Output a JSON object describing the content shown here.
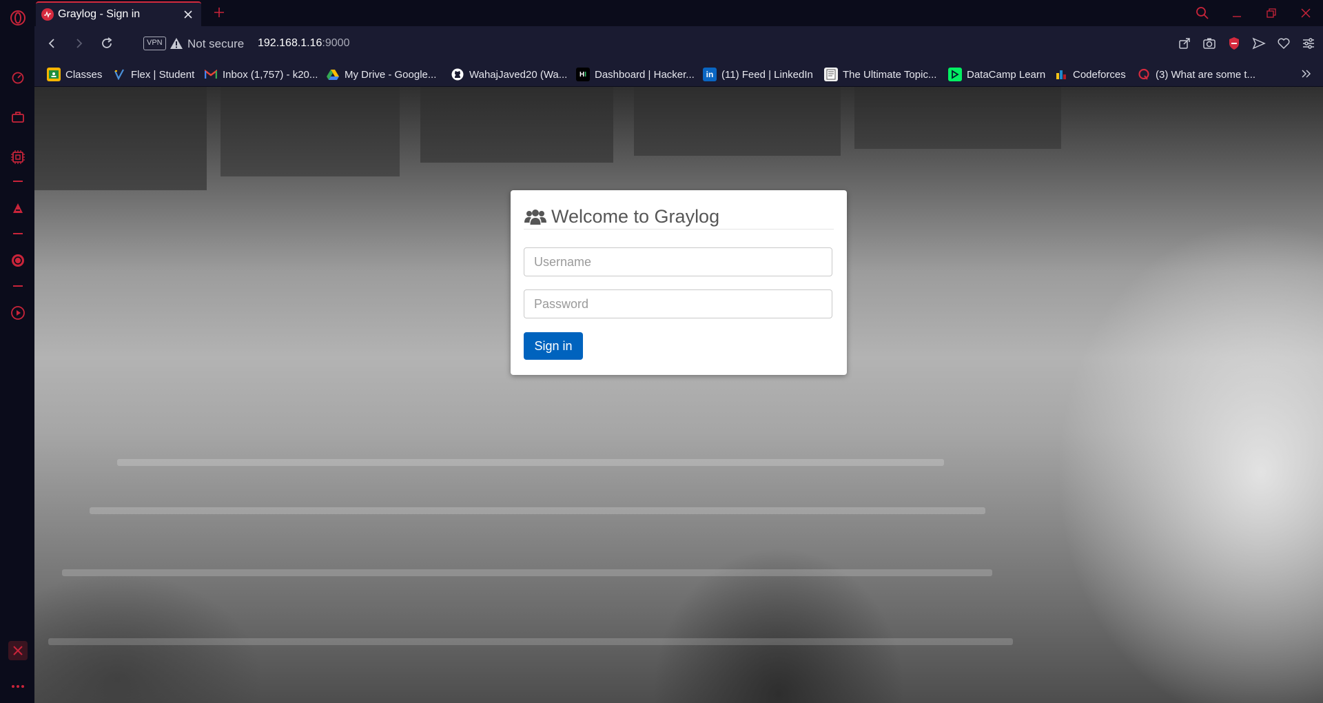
{
  "browser": {
    "tab": {
      "title": "Graylog - Sign in"
    },
    "address": {
      "vpn_label": "VPN",
      "security_text": "Not secure",
      "url_host": "192.168.1.16",
      "url_port": ":9000"
    },
    "bookmarks": [
      {
        "label": "Classes",
        "icon": "google-classroom-icon"
      },
      {
        "label": "Flex | Student",
        "icon": "flex-icon"
      },
      {
        "label": "Inbox (1,757) - k20...",
        "icon": "gmail-icon"
      },
      {
        "label": "My Drive - Google...",
        "icon": "google-drive-icon"
      },
      {
        "label": "WahajJaved20 (Wa...",
        "icon": "github-icon"
      },
      {
        "label": "Dashboard | Hacker...",
        "icon": "hackerrank-icon"
      },
      {
        "label": "(11) Feed | LinkedIn",
        "icon": "linkedin-icon"
      },
      {
        "label": "The Ultimate Topic...",
        "icon": "document-icon"
      },
      {
        "label": "DataCamp Learn",
        "icon": "datacamp-icon"
      },
      {
        "label": "Codeforces",
        "icon": "codeforces-icon"
      },
      {
        "label": "(3) What are some t...",
        "icon": "quora-icon"
      }
    ],
    "colors": {
      "accent": "#d52a3e",
      "toolbar": "#1a1b31",
      "frame": "#0b0c1b"
    }
  },
  "login": {
    "title": "Welcome to Graylog",
    "username_placeholder": "Username",
    "password_placeholder": "Password",
    "submit_label": "Sign in",
    "button_color": "#0063be"
  }
}
